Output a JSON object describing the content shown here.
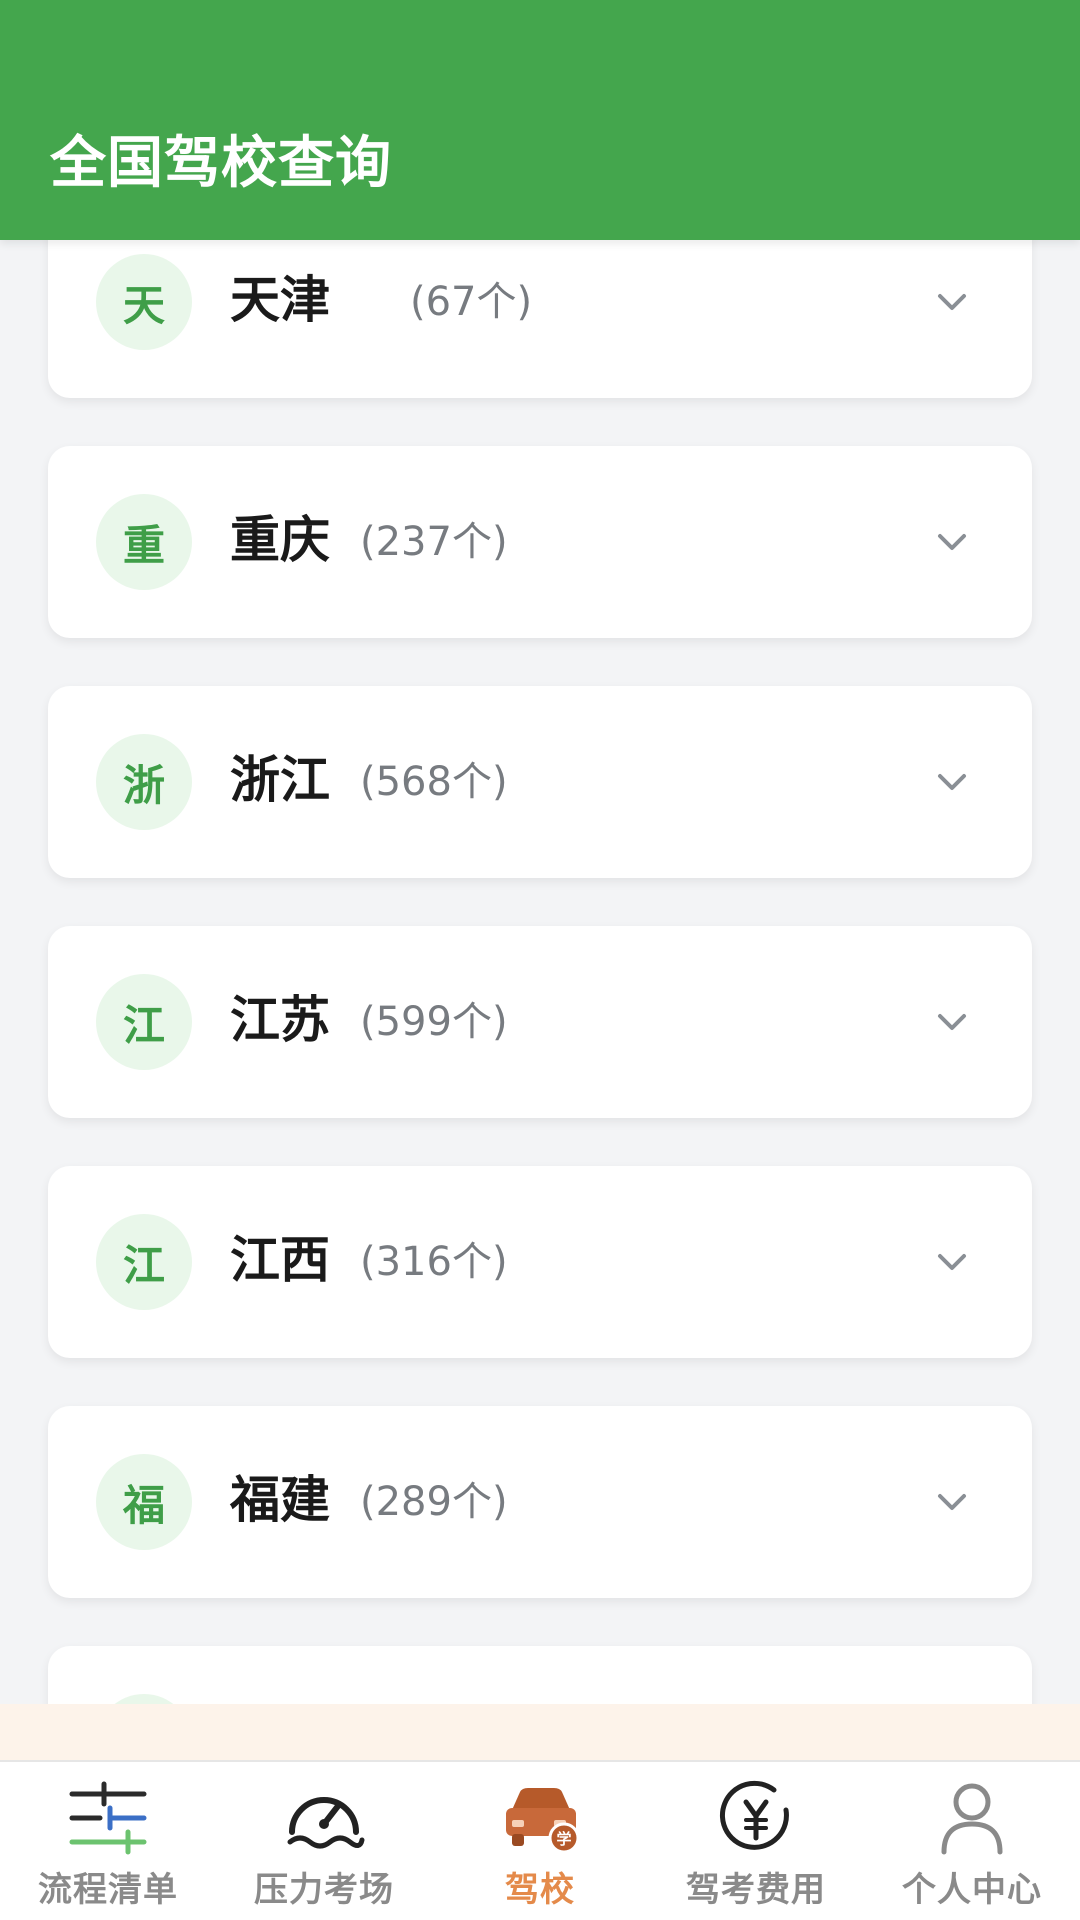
{
  "header": {
    "title": "全国驾校查询"
  },
  "provinces": [
    {
      "initial": "天",
      "name": "天津",
      "count": "(67个)"
    },
    {
      "initial": "重",
      "name": "重庆",
      "count": "(237个)"
    },
    {
      "initial": "浙",
      "name": "浙江",
      "count": "(568个)"
    },
    {
      "initial": "江",
      "name": "江苏",
      "count": "(599个)"
    },
    {
      "initial": "江",
      "name": "江西",
      "count": "(316个)"
    },
    {
      "initial": "福",
      "name": "福建",
      "count": "(289个)"
    }
  ],
  "tabbar": {
    "active_index": 2,
    "items": [
      {
        "label": "流程清单",
        "icon": "sliders-icon"
      },
      {
        "label": "压力考场",
        "icon": "speedometer-icon"
      },
      {
        "label": "驾校",
        "icon": "car-school-icon"
      },
      {
        "label": "驾考费用",
        "icon": "yuan-coin-icon"
      },
      {
        "label": "个人中心",
        "icon": "user-icon"
      }
    ]
  },
  "colors": {
    "header_bg": "#44a64d",
    "accent_green": "#3f9e48",
    "avatar_bg": "#e9f7ea",
    "tab_active": "#e48a4a",
    "tab_inactive": "#8a8a8a",
    "page_bg": "#f3f4f6"
  }
}
